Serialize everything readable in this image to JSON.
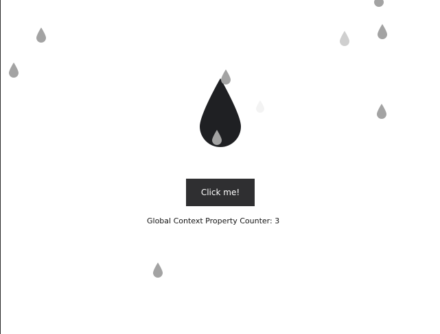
{
  "button": {
    "label": "Click me!"
  },
  "counter": {
    "label": "Global Context Property Counter:",
    "value": "3"
  },
  "icons": {
    "main": "water-drop-icon",
    "falling": "raindrop-icon"
  },
  "colors": {
    "background": "#ffffff",
    "main_drop": "#1f2023",
    "falling_drop": "#a3a3a3",
    "faint_drop": "#d4d4d4",
    "button_bg": "#2f2f31",
    "button_text": "#ffffff",
    "text": "#111111"
  }
}
